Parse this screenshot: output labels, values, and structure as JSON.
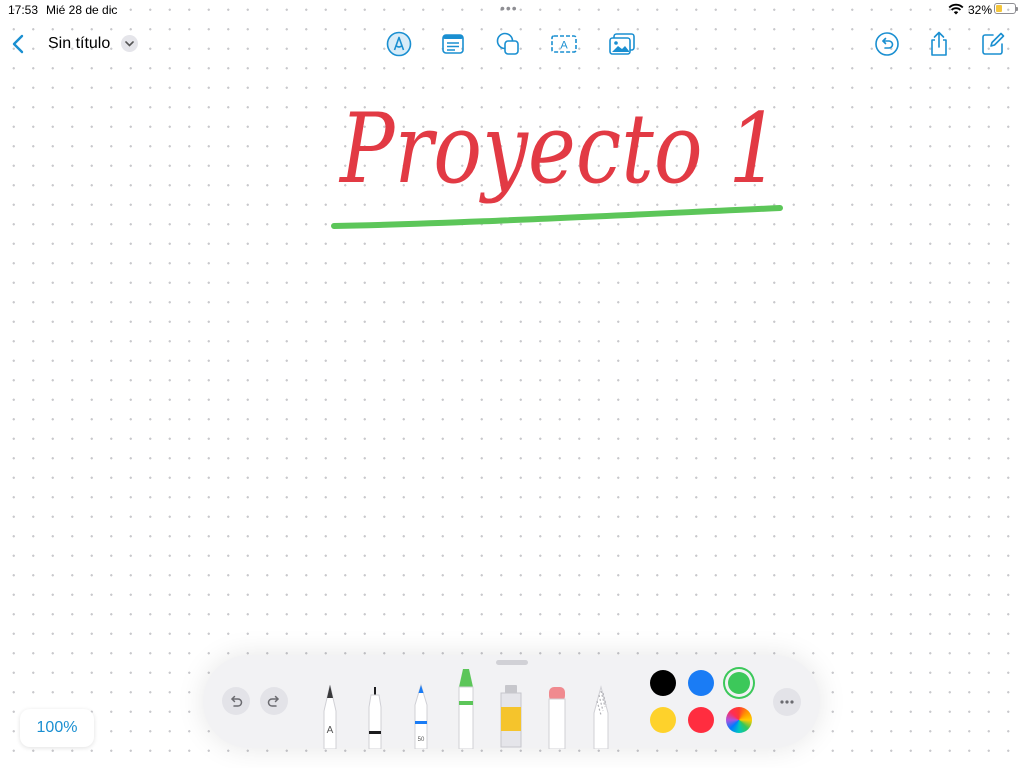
{
  "status": {
    "time": "17:53",
    "date": "Mié 28 de dic",
    "battery": "32%",
    "battery_level": 0.32
  },
  "header": {
    "title": "Sin título"
  },
  "canvas": {
    "handwritten_text": "Proyecto 1",
    "text_color": "#e23a44",
    "underline_color": "#5cc659"
  },
  "zoom": {
    "label": "100%"
  },
  "palette": {
    "tools": [
      "pen",
      "fineliner",
      "pencil",
      "crayon",
      "paint-brush",
      "eraser",
      "lasso"
    ],
    "pen_label": "A",
    "pencil_label": "50",
    "colors": [
      "#000000",
      "#1a7cf5",
      "#3cc85a",
      "#fed22b",
      "#ff2d3f",
      "color-wheel"
    ],
    "selected_color": "#3cc85a"
  },
  "colors": {
    "accent": "#1a8fd1"
  }
}
